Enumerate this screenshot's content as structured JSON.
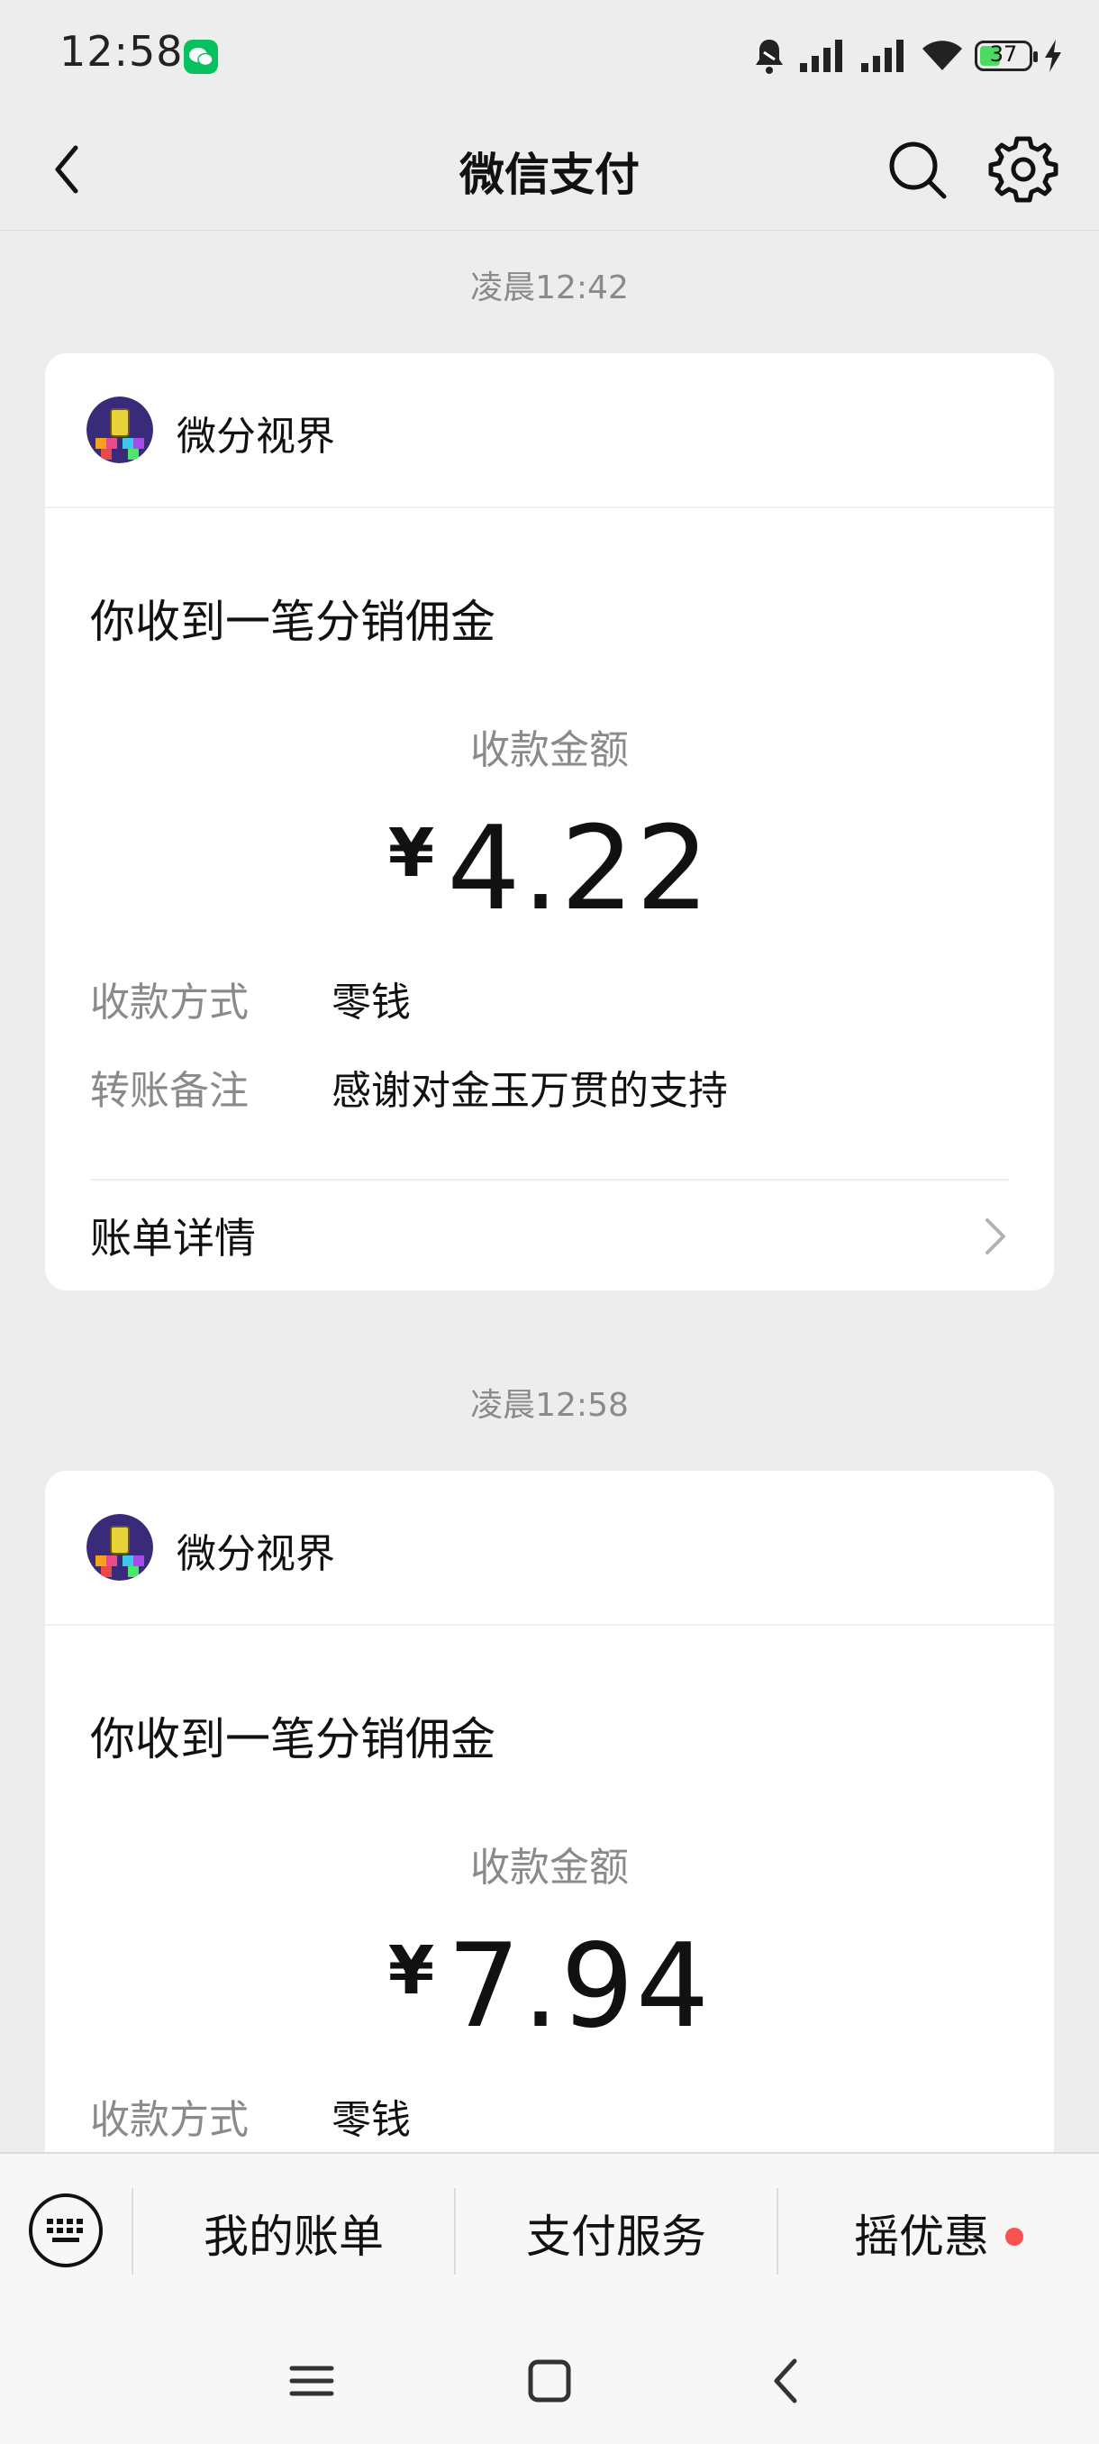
{
  "status_bar": {
    "time": "12:58",
    "battery": "37"
  },
  "nav": {
    "title": "微信支付"
  },
  "messages": [
    {
      "timestamp": "凌晨12:42",
      "merchant": "微分视界",
      "title": "你收到一笔分销佣金",
      "amount_label": "收款金额",
      "currency": "¥",
      "amount": "4.22",
      "rows": [
        {
          "label": "收款方式",
          "value": "零钱"
        },
        {
          "label": "转账备注",
          "value": "感谢对金玉万贯的支持"
        }
      ],
      "detail_label": "账单详情"
    },
    {
      "timestamp": "凌晨12:58",
      "merchant": "微分视界",
      "title": "你收到一笔分销佣金",
      "amount_label": "收款金额",
      "currency": "¥",
      "amount": "7.94",
      "rows": [
        {
          "label": "收款方式",
          "value": "零钱"
        }
      ]
    }
  ],
  "bottom_menu": {
    "items": [
      "我的账单",
      "支付服务",
      "摇优惠"
    ]
  },
  "colors": {
    "accent_green": "#07c160",
    "badge_red": "#fa5151",
    "background": "#ededed"
  },
  "icons": [
    "wechat-icon",
    "bell-muted-icon",
    "signal-icon",
    "wifi-icon",
    "battery-icon",
    "charging-icon",
    "back-arrow-icon",
    "search-icon",
    "gear-icon",
    "chevron-right-icon",
    "keyboard-icon",
    "menu-icon",
    "home-icon",
    "back-icon"
  ]
}
